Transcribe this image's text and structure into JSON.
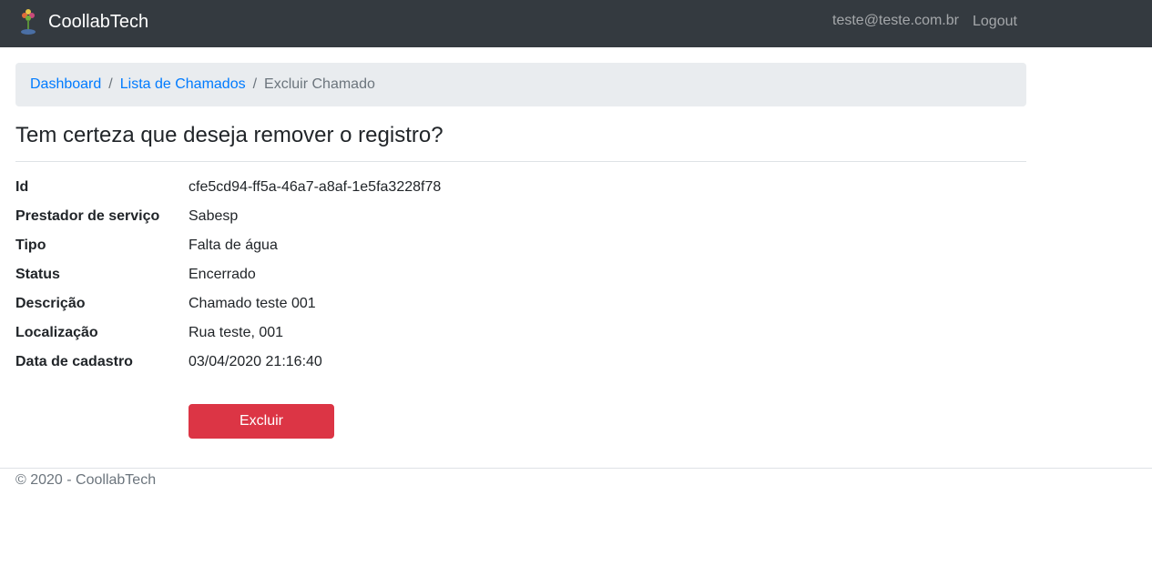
{
  "navbar": {
    "brand_name": "CoollabTech",
    "logo_icon": "flower-logo-icon",
    "user_email": "teste@teste.com.br",
    "logout_label": "Logout"
  },
  "breadcrumb": {
    "items": [
      "Dashboard",
      "Lista de Chamados"
    ],
    "separator": "/",
    "active": "Excluir Chamado"
  },
  "page": {
    "title": "Tem certeza que deseja remover o registro?"
  },
  "details": [
    {
      "label": "Id",
      "value": "cfe5cd94-ff5a-46a7-a8af-1e5fa3228f78"
    },
    {
      "label": "Prestador de serviço",
      "value": "Sabesp"
    },
    {
      "label": "Tipo",
      "value": "Falta de água"
    },
    {
      "label": "Status",
      "value": "Encerrado"
    },
    {
      "label": "Descrição",
      "value": "Chamado teste 001"
    },
    {
      "label": "Localização",
      "value": "Rua teste, 001"
    },
    {
      "label": "Data de cadastro",
      "value": "03/04/2020 21:16:40"
    }
  ],
  "actions": {
    "delete_label": "Excluir"
  },
  "footer": {
    "text": "© 2020 - CoollabTech"
  },
  "colors": {
    "navbar_bg": "#343a40",
    "link": "#007bff",
    "danger": "#dc3545",
    "breadcrumb_bg": "#e9ecef"
  }
}
